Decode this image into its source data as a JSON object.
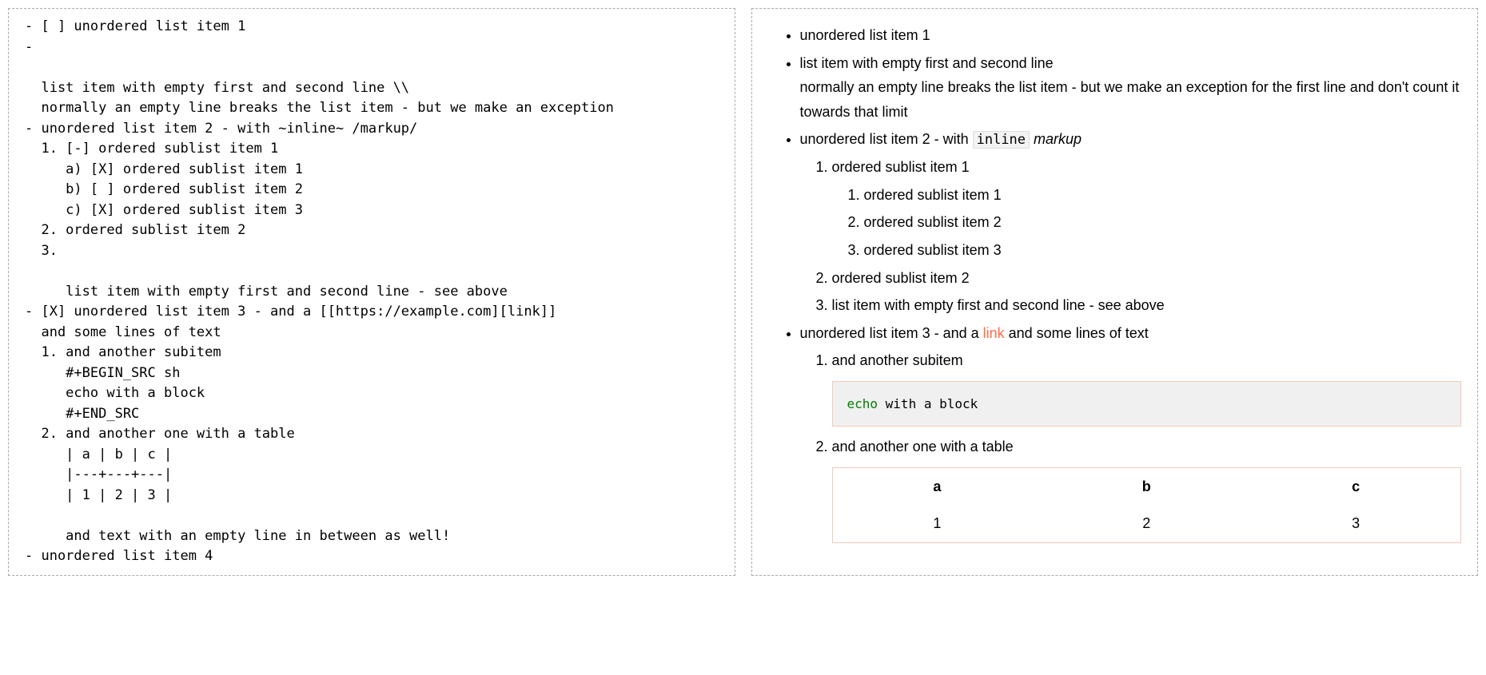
{
  "source_lines": [
    "- [ ] unordered list item 1",
    "-",
    "",
    "  list item with empty first and second line \\\\",
    "  normally an empty line breaks the list item - but we make an exception",
    "- unordered list item 2 - with ~inline~ /markup/",
    "  1. [-] ordered sublist item 1",
    "     a) [X] ordered sublist item 1",
    "     b) [ ] ordered sublist item 2",
    "     c) [X] ordered sublist item 3",
    "  2. ordered sublist item 2",
    "  3.",
    "",
    "     list item with empty first and second line - see above",
    "- [X] unordered list item 3 - and a [[https://example.com][link]]",
    "  and some lines of text",
    "  1. and another subitem",
    "     #+BEGIN_SRC sh",
    "     echo with a block",
    "     #+END_SRC",
    "  2. and another one with a table",
    "     | a | b | c |",
    "     |---+---+---|",
    "     | 1 | 2 | 3 |",
    "",
    "     and text with an empty line in between as well!",
    "- unordered list item 4"
  ],
  "rendered": {
    "item1": "unordered list item 1",
    "item2_line1": "list item with empty first and second line",
    "item2_line2": "normally an empty line breaks the list item - but we make an exception for the first line and don't count it towards that limit",
    "item3_prefix": "unordered list item 2 - with ",
    "item3_code": "inline",
    "item3_markup": "markup",
    "ol1": "ordered sublist item 1",
    "ol1a": "ordered sublist item 1",
    "ol1b": "ordered sublist item 2",
    "ol1c": "ordered sublist item 3",
    "ol2": "ordered sublist item 2",
    "ol3": "list item with empty first and second line - see above",
    "item4_prefix": "unordered list item 3 - and a ",
    "item4_link": "link",
    "item4_suffix": " and some lines of text",
    "sub1": "and another subitem",
    "code_kw": "echo",
    "code_rest": " with a block",
    "sub2": "and another one with a table",
    "th_a": "a",
    "th_b": "b",
    "th_c": "c",
    "td_1": "1",
    "td_2": "2",
    "td_3": "3"
  }
}
